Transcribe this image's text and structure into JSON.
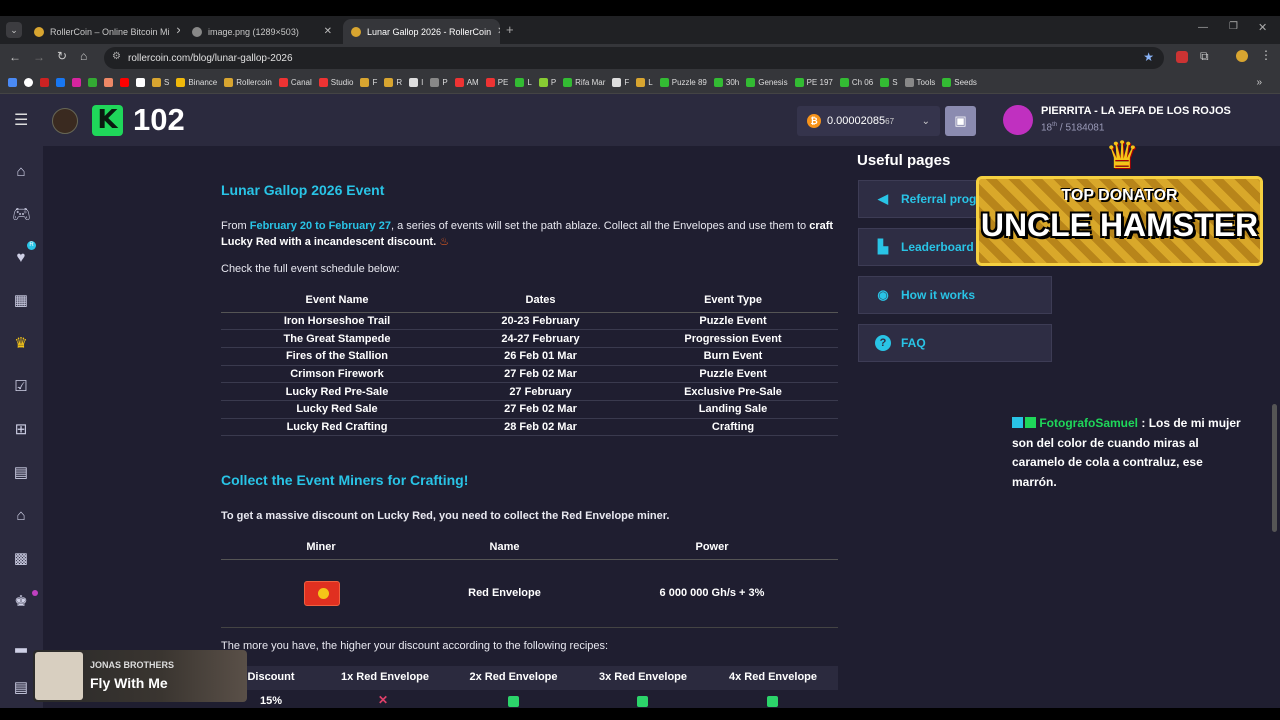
{
  "tabs": [
    {
      "label": "RollerCoin – Online Bitcoin Mi"
    },
    {
      "label": "image.png (1289×503)"
    },
    {
      "label": "Lunar Gallop 2026 - RollerCoin"
    }
  ],
  "address": {
    "url": "rollercoin.com/blog/lunar-gallop-2026"
  },
  "bookmarks": [
    {
      "label": "S",
      "color": "#d8a530"
    },
    {
      "label": "Binance",
      "color": "#f0b90b"
    },
    {
      "label": "Rollercoin",
      "color": "#d8a530"
    },
    {
      "label": "Canal",
      "color": "#e33"
    },
    {
      "label": "Studio",
      "color": "#e33"
    },
    {
      "label": "F",
      "color": "#d8a530"
    },
    {
      "label": "R",
      "color": "#d8a530"
    },
    {
      "label": "I",
      "color": "#ddd"
    },
    {
      "label": "P",
      "color": "#888"
    },
    {
      "label": "AM",
      "color": "#e33"
    },
    {
      "label": "PE",
      "color": "#e33"
    },
    {
      "label": "L",
      "color": "#3b3"
    },
    {
      "label": "P",
      "color": "#8c3"
    },
    {
      "label": "Rifa Mar",
      "color": "#3b3"
    },
    {
      "label": "F",
      "color": "#ddd"
    },
    {
      "label": "L",
      "color": "#d8a530"
    },
    {
      "label": "Puzzle 89",
      "color": "#3b3"
    },
    {
      "label": "30h",
      "color": "#3b3"
    },
    {
      "label": "Genesis",
      "color": "#3b3"
    },
    {
      "label": "PE 197",
      "color": "#3b3"
    },
    {
      "label": "Ch 06",
      "color": "#3b3"
    },
    {
      "label": "S",
      "color": "#3b3"
    },
    {
      "label": "Tools",
      "color": "#888"
    },
    {
      "label": "Seeds",
      "color": "#3b3"
    }
  ],
  "header": {
    "level": "102",
    "balance_main": "0.00002085",
    "balance_small": "67",
    "username": "PIERRITA - LA JEFA DE LOS ROJOS",
    "rank_num": "18",
    "rank_suffix": "th",
    "rank_total": "/ 5184081"
  },
  "article": {
    "title": "Lunar Gallop 2026 Event",
    "intro_prefix": "From ",
    "intro_dates": "February 20 to February 27",
    "intro_middle": ", a series of events will set the path ablaze. Collect all the Envelopes and use them to ",
    "intro_bold": "craft Lucky Red with a incandescent discount.",
    "schedule_note": "Check the full event schedule below:",
    "schedule_headers": [
      "Event Name",
      "Dates",
      "Event Type"
    ],
    "schedule": [
      [
        "Iron Horseshoe Trail",
        "20-23 February",
        "Puzzle Event"
      ],
      [
        "The Great Stampede",
        "24-27 February",
        "Progression Event"
      ],
      [
        "Fires of the Stallion",
        "26 Feb 01 Mar",
        "Burn Event"
      ],
      [
        "Crimson Firework",
        "27 Feb 02 Mar",
        "Puzzle Event"
      ],
      [
        "Lucky Red Pre-Sale",
        "27 February",
        "Exclusive Pre-Sale"
      ],
      [
        "Lucky Red Sale",
        "27 Feb 02 Mar",
        "Landing Sale"
      ],
      [
        "Lucky Red Crafting",
        "28 Feb 02 Mar",
        "Crafting"
      ]
    ],
    "section2_title": "Collect the Event Miners for Crafting!",
    "section2_text": "To get a massive discount on Lucky Red, you need to collect the Red Envelope miner.",
    "miner_headers": [
      "Miner",
      "Name",
      "Power"
    ],
    "miner_name": "Red Envelope",
    "miner_power": "6 000 000 Gh/s + 3%",
    "recipes_note": "The more you have, the higher your discount according to the following recipes:",
    "recipe_headers": [
      "Discount",
      "1x Red Envelope",
      "2x Red Envelope",
      "3x Red Envelope",
      "4x Red Envelope"
    ],
    "recipe_first_discount": "15%"
  },
  "useful": {
    "title": "Useful pages",
    "items": [
      "Referral progr",
      "Leaderboard",
      "How it works",
      "FAQ"
    ]
  },
  "overlay": {
    "banner_top": "TOP DONATOR",
    "banner_name": "UNCLE HAMSTER",
    "chat_user": "FotografoSamuel",
    "chat_sep": " : ",
    "chat_text": "Los de mi mujer son del color de cuando miras al caramelo de cola a contraluz, ese marrón."
  },
  "music": {
    "artist": "JONAS BROTHERS",
    "song": "Fly With Me"
  },
  "colors": {
    "accent": "#29c4e6",
    "background": "#1f1e30",
    "panel": "#2b2a3e",
    "brand_green": "#1fd75a"
  }
}
